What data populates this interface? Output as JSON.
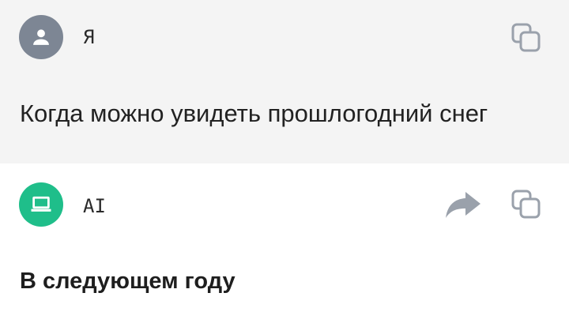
{
  "messages": [
    {
      "role": "user",
      "author": "Я",
      "avatar_icon": "person-icon",
      "avatar_color": "#7d8694",
      "text": "Когда можно увидеть прошлогодний снег",
      "actions": [
        "copy-icon"
      ]
    },
    {
      "role": "assistant",
      "author": "AI",
      "avatar_icon": "laptop-icon",
      "avatar_color": "#1fbe8a",
      "text": "В следующем году",
      "actions": [
        "share-icon",
        "copy-icon"
      ]
    }
  ],
  "colors": {
    "user_background": "#f4f4f4",
    "ai_background": "#ffffff",
    "icon_gray": "#9aa1ab"
  }
}
